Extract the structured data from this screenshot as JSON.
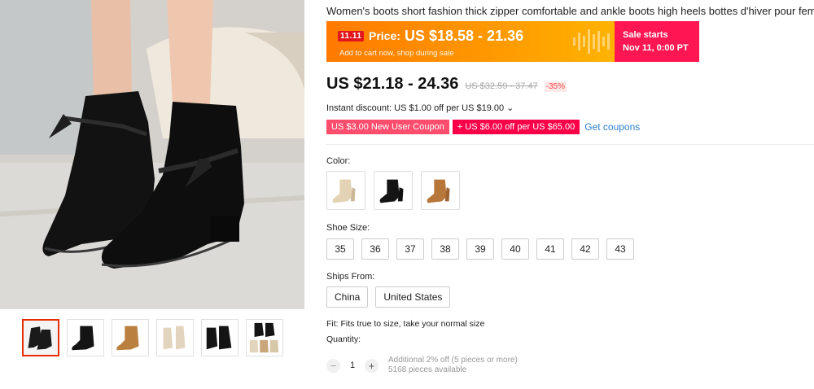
{
  "product": {
    "title": "Women's boots short fashion thick zipper comfortable and ankle boots high heels bottes d'hiver pour femmes"
  },
  "gallery": {
    "thumb_colors": [
      "#1a1a1a",
      "#141414",
      "#b9803f",
      "#e3d5bd",
      "#141414",
      "#c9a57a"
    ]
  },
  "promo": {
    "badge": "11.11",
    "price_label": "Price:",
    "price_range": "US $18.58 - 21.36",
    "subtext": "Add to cart now, shop during sale",
    "sale_starts_label": "Sale starts",
    "sale_date": "Nov 11, 0:00 PT",
    "left_color": "#ff8a00",
    "right_color": "#ff1652"
  },
  "pricing": {
    "price": "US $21.18 - 24.36",
    "original_price": "US $32.59 - 37.47",
    "discount": "-35%"
  },
  "instant_discount": "Instant discount: US $1.00 off per US $19.00 ⌄",
  "coupons": {
    "new_user": "US $3.00 New User Coupon",
    "store": "+ US $6.00 off per US $65.00",
    "get_link": "Get coupons"
  },
  "color": {
    "label": "Color:",
    "options": [
      {
        "name": "beige",
        "color": "#e3d3b4"
      },
      {
        "name": "black",
        "color": "#151515"
      },
      {
        "name": "brown",
        "color": "#b8773a"
      }
    ]
  },
  "shoe_size": {
    "label": "Shoe Size:",
    "options": [
      "35",
      "36",
      "37",
      "38",
      "39",
      "40",
      "41",
      "42",
      "43"
    ]
  },
  "ships_from": {
    "label": "Ships From:",
    "options": [
      "China",
      "United States"
    ]
  },
  "fit": "Fit: Fits true to size, take your normal size",
  "quantity": {
    "label": "Quantity:",
    "value": "1",
    "minus": "−",
    "plus": "+",
    "bulk_note": "Additional 2% off (5 pieces or more)",
    "available": "5168 pieces available"
  }
}
